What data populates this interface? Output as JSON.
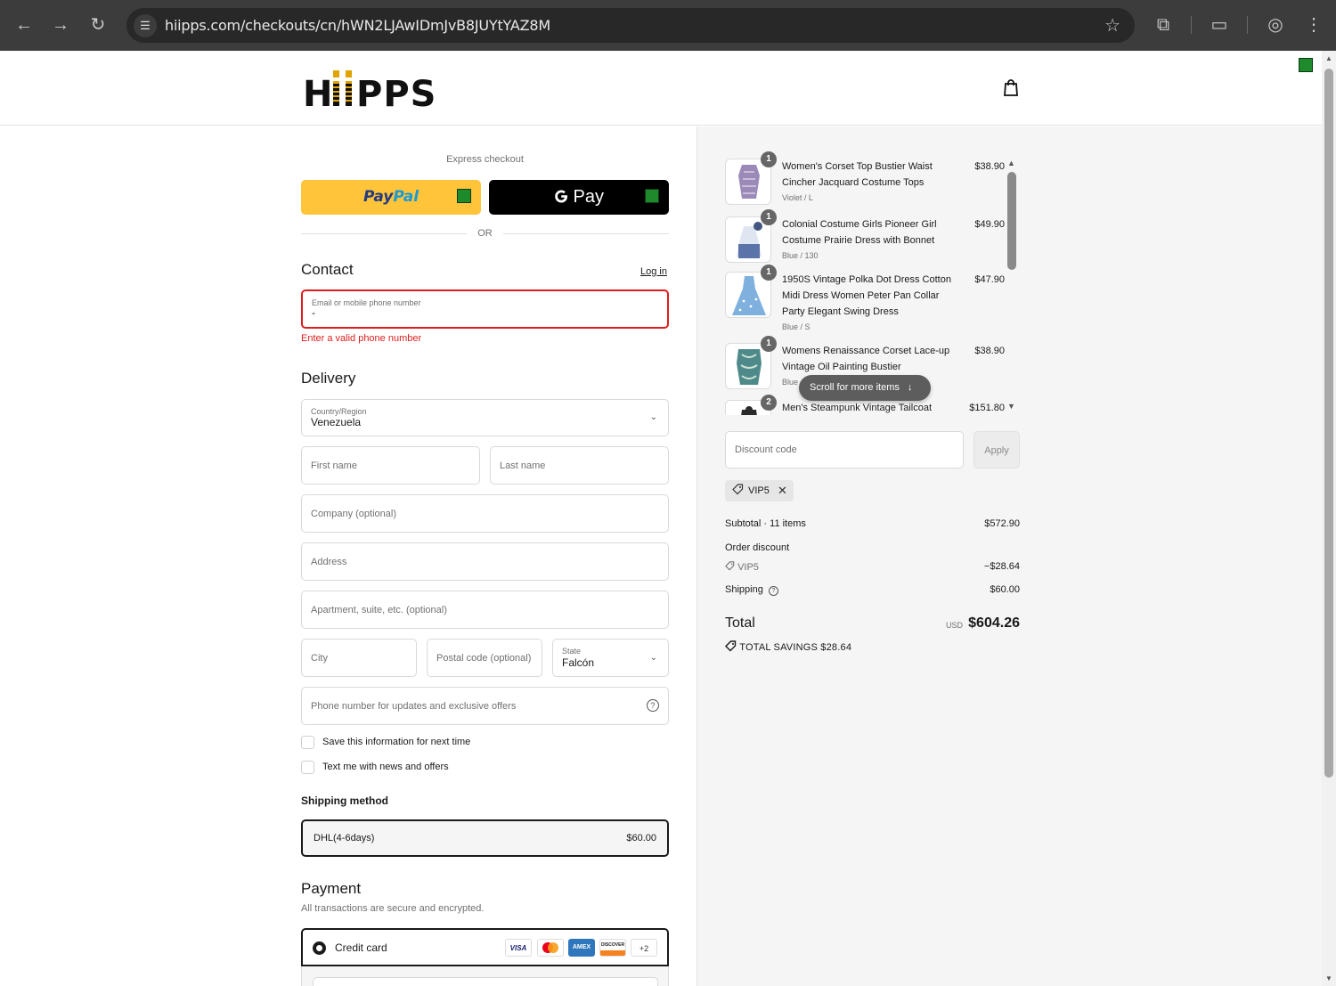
{
  "browser": {
    "url": "hiipps.com/checkouts/cn/hWN2LJAwIDmJvB8JUYtYAZ8M",
    "back_icon": "back-arrow-icon",
    "forward_icon": "forward-arrow-icon",
    "reload_icon": "reload-icon"
  },
  "brand": {
    "logo_text": "HIIPPS",
    "accent": "#e0a300"
  },
  "express": {
    "label": "Express checkout",
    "paypal_label_1": "Pay",
    "paypal_label_2": "Pal",
    "gpay_label": "Pay",
    "or": "OR"
  },
  "contact": {
    "heading": "Contact",
    "login": "Log in",
    "email_label": "Email or mobile phone number",
    "email_value": "-",
    "error": "Enter a valid phone number"
  },
  "delivery": {
    "heading": "Delivery",
    "country_label": "Country/Region",
    "country_value": "Venezuela",
    "first_name": "First name",
    "last_name": "Last name",
    "company": "Company (optional)",
    "address": "Address",
    "apartment": "Apartment, suite, etc. (optional)",
    "city": "City",
    "postal": "Postal code (optional)",
    "state_label": "State",
    "state_value": "Falcón",
    "phone": "Phone number for updates and exclusive offers",
    "save_info": "Save this information for next time",
    "text_me": "Text me with news and offers"
  },
  "shipping": {
    "heading": "Shipping method",
    "method_name": "DHL(4-6days)",
    "method_price": "$60.00"
  },
  "payment": {
    "heading": "Payment",
    "subtitle": "All transactions are secure and encrypted.",
    "credit_card": "Credit card",
    "cards": [
      "VISA",
      "MC",
      "AMEX",
      "DISCOVER"
    ],
    "more_cards": "+2"
  },
  "cart": {
    "items": [
      {
        "qty": "1",
        "name": "Women's Corset Top Bustier Waist Cincher Jacquard Costume Tops",
        "variant": "Violet / L",
        "price": "$38.90"
      },
      {
        "qty": "1",
        "name": "Colonial Costume Girls Pioneer Girl Costume Prairie Dress with Bonnet",
        "variant": "Blue / 130",
        "price": "$49.90"
      },
      {
        "qty": "1",
        "name": "1950S Vintage Polka Dot Dress Cotton Midi Dress Women Peter Pan Collar Party Elegant Swing Dress",
        "variant": "Blue / S",
        "price": "$47.90"
      },
      {
        "qty": "1",
        "name": "Womens Renaissance Corset Lace-up Vintage Oil Painting Bustier",
        "variant": "Blue",
        "price": "$38.90"
      },
      {
        "qty": "2",
        "name": "Men's Steampunk Vintage Tailcoat",
        "variant": "",
        "price": "$151.80"
      }
    ],
    "scroll_hint": "Scroll for more items"
  },
  "discount": {
    "placeholder": "Discount code",
    "apply": "Apply",
    "code": "VIP5"
  },
  "summary": {
    "subtotal_label": "Subtotal · 11 items",
    "subtotal": "$572.90",
    "order_discount_label": "Order discount",
    "discount_code": "VIP5",
    "discount_value": "−$28.64",
    "shipping_label": "Shipping",
    "shipping_value": "$60.00",
    "total_label": "Total",
    "currency": "USD",
    "total": "$604.26",
    "savings": "TOTAL SAVINGS  $28.64"
  }
}
